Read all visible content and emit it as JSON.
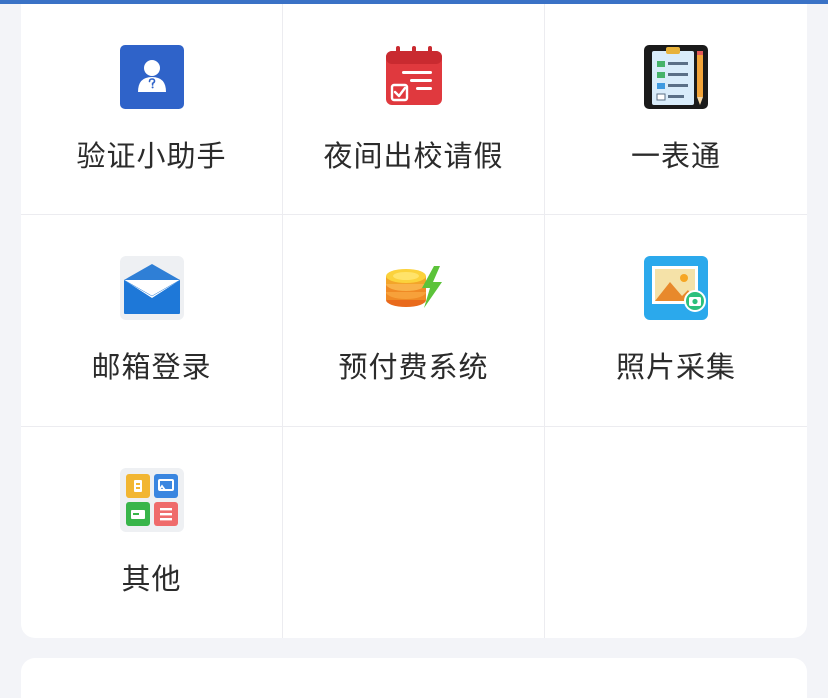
{
  "services": [
    {
      "label": "验证小助手",
      "icon": "verify-assistant-icon"
    },
    {
      "label": "夜间出校请假",
      "icon": "calendar-leave-icon"
    },
    {
      "label": "一表通",
      "icon": "form-clipboard-icon"
    },
    {
      "label": "邮箱登录",
      "icon": "mail-envelope-icon"
    },
    {
      "label": "预付费系统",
      "icon": "prepaid-coins-icon"
    },
    {
      "label": "照片采集",
      "icon": "photo-capture-icon"
    },
    {
      "label": "其他",
      "icon": "more-apps-icon"
    }
  ],
  "colors": {
    "accent": "#3a72c6",
    "background": "#f3f4f8",
    "card": "#ffffff"
  }
}
